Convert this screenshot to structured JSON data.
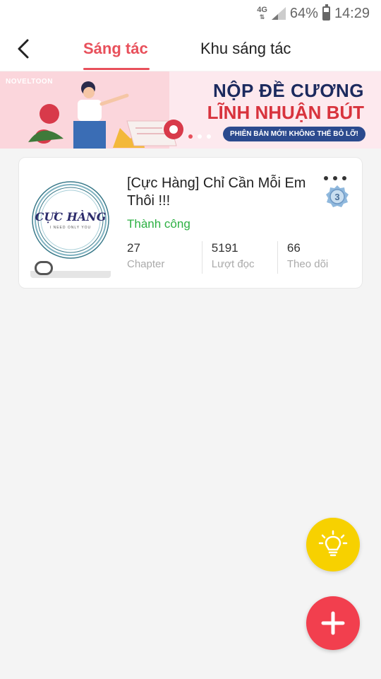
{
  "status_bar": {
    "network": "4G",
    "battery": "64%",
    "battery_level": 0.64,
    "time": "14:29"
  },
  "header": {
    "tabs": [
      {
        "label": "Sáng tác",
        "active": true
      },
      {
        "label": "Khu sáng tác",
        "active": false
      }
    ]
  },
  "banner": {
    "logo": "NOVELTOON",
    "title_line1": "NỘP ĐỀ CƯƠNG",
    "title_line2": "LĨNH NHUẬN BÚT",
    "pill": "PHIÊN BẢN MỚI! KHÔNG THỂ BỎ LỠ!"
  },
  "work": {
    "cover_title": "CỰC HÀNG",
    "cover_subtitle": "I NEED ONLY YOU",
    "title": "[Cực Hàng] Chỉ Cần Mỗi Em Thôi !!!",
    "status": "Thành công",
    "level": "3",
    "stats": [
      {
        "value": "27",
        "label": "Chapter"
      },
      {
        "value": "5191",
        "label": "Lượt đọc"
      },
      {
        "value": "66",
        "label": "Theo dõi"
      }
    ]
  },
  "colors": {
    "accent": "#e8505b",
    "success": "#2db043",
    "fab_idea": "#f7d100",
    "fab_add": "#f23f4e"
  },
  "icons": [
    "back-arrow-icon",
    "more-icon",
    "level-badge-icon",
    "lightbulb-icon",
    "plus-icon",
    "chat-icon",
    "signal-icon",
    "battery-icon"
  ]
}
